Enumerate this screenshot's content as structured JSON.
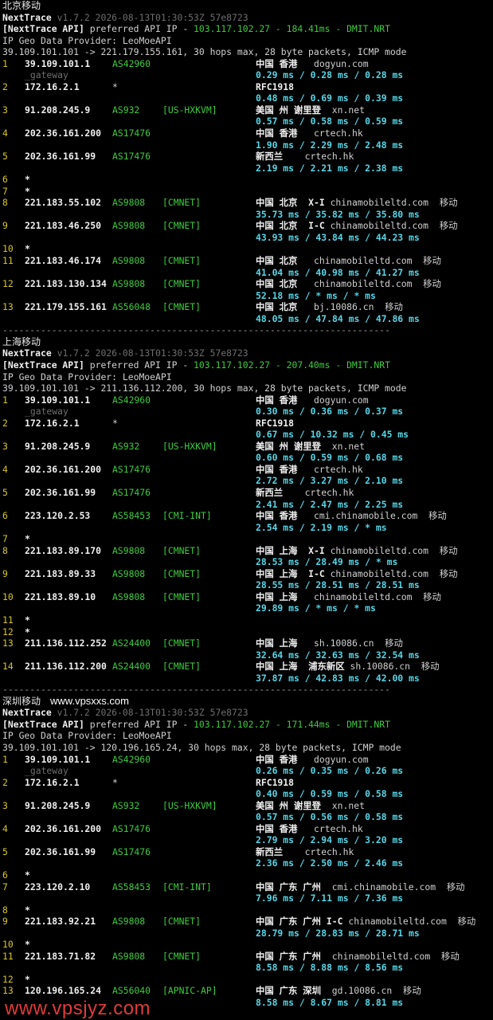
{
  "sections": [
    {
      "title": "北京移动",
      "site": "",
      "version_name": "NextTrace",
      "version_info": "v1.7.2 2026-08-13T01:30:53Z 57e8723",
      "api_prefix": "[NextTrace API]",
      "api_text": " preferred API IP - ",
      "api_ip": "103.117.102.27",
      "api_sep1": " - ",
      "api_ms": "184.41ms",
      "api_sep2": " - ",
      "api_node": "DMIT.NRT",
      "geo_provider": "IP Geo Data Provider: LeoMoeAPI",
      "trace_line": "39.109.101.101 -> 221.179.155.161, 30 hops max, 28 byte packets, ICMP mode",
      "hops": [
        {
          "n": "1",
          "ip": "39.109.101.1",
          "asn": "AS42960",
          "tag": "",
          "geo": "中国 香港",
          "host": "   dogyun.com",
          "isp": "",
          "rtt": "0.29 ms / 0.28 ms / 0.28 ms",
          "sub": "_gateway"
        },
        {
          "n": "2",
          "ip": "172.16.2.1",
          "asn": "*",
          "tag": "",
          "geo": "RFC1918",
          "host": "",
          "isp": "",
          "rtt": "0.48 ms / 0.69 ms / 0.39 ms",
          "sub": ""
        },
        {
          "n": "3",
          "ip": "91.208.245.9",
          "asn": "AS932",
          "tag": "[US-HXKVM]",
          "geo": "美国 州 谢里登",
          "host": "  xn.net",
          "isp": "",
          "rtt": "0.57 ms / 0.58 ms / 0.59 ms",
          "sub": ""
        },
        {
          "n": "4",
          "ip": "202.36.161.200",
          "asn": "AS17476",
          "tag": "",
          "geo": "中国 香港",
          "host": "   crtech.hk",
          "isp": "",
          "rtt": "1.90 ms / 2.29 ms / 2.48 ms",
          "sub": ""
        },
        {
          "n": "5",
          "ip": "202.36.161.99",
          "asn": "AS17476",
          "tag": "",
          "geo": "新西兰",
          "host": "    crtech.hk",
          "isp": "",
          "rtt": "2.19 ms / 2.21 ms / 2.38 ms",
          "sub": ""
        },
        {
          "n": "6",
          "ip": "*",
          "asn": "",
          "tag": "",
          "geo": "",
          "host": "",
          "isp": "",
          "rtt": "",
          "sub": ""
        },
        {
          "n": "7",
          "ip": "*",
          "asn": "",
          "tag": "",
          "geo": "",
          "host": "",
          "isp": "",
          "rtt": "",
          "sub": ""
        },
        {
          "n": "8",
          "ip": "221.183.55.102",
          "asn": "AS9808",
          "tag": "[CMNET]",
          "geo": "中国 北京  X-I",
          "host": " chinamobileltd.com",
          "isp": "  移动",
          "rtt": "35.73 ms / 35.82 ms / 35.80 ms",
          "sub": ""
        },
        {
          "n": "9",
          "ip": "221.183.46.250",
          "asn": "AS9808",
          "tag": "[CMNET]",
          "geo": "中国 北京  I-C",
          "host": " chinamobileltd.com",
          "isp": "  移动",
          "rtt": "43.93 ms / 43.84 ms / 44.23 ms",
          "sub": ""
        },
        {
          "n": "10",
          "ip": "*",
          "asn": "",
          "tag": "",
          "geo": "",
          "host": "",
          "isp": "",
          "rtt": "",
          "sub": ""
        },
        {
          "n": "11",
          "ip": "221.183.46.174",
          "asn": "AS9808",
          "tag": "[CMNET]",
          "geo": "中国 北京",
          "host": "   chinamobileltd.com",
          "isp": "  移动",
          "rtt": "41.04 ms / 40.98 ms / 41.27 ms",
          "sub": ""
        },
        {
          "n": "12",
          "ip": "221.183.130.134",
          "asn": "AS9808",
          "tag": "[CMNET]",
          "geo": "中国 北京",
          "host": "   chinamobileltd.com",
          "isp": "  移动",
          "rtt": "52.18 ms / * ms / * ms",
          "sub": ""
        },
        {
          "n": "13",
          "ip": "221.179.155.161",
          "asn": "AS56048",
          "tag": "[CMNET]",
          "geo": "中国 北京",
          "host": "   bj.10086.cn",
          "isp": "  移动",
          "rtt": "48.05 ms / 47.84 ms / 47.86 ms",
          "sub": ""
        }
      ]
    },
    {
      "title": "上海移动",
      "site": "",
      "version_name": "NextTrace",
      "version_info": "v1.7.2 2026-08-13T01:30:53Z 57e8723",
      "api_prefix": "[NextTrace API]",
      "api_text": " preferred API IP - ",
      "api_ip": "103.117.102.27",
      "api_sep1": " - ",
      "api_ms": "207.40ms",
      "api_sep2": " - ",
      "api_node": "DMIT.NRT",
      "geo_provider": "IP Geo Data Provider: LeoMoeAPI",
      "trace_line": "39.109.101.101 -> 211.136.112.200, 30 hops max, 28 byte packets, ICMP mode",
      "hops": [
        {
          "n": "1",
          "ip": "39.109.101.1",
          "asn": "AS42960",
          "tag": "",
          "geo": "中国 香港",
          "host": "   dogyun.com",
          "isp": "",
          "rtt": "0.30 ms / 0.36 ms / 0.37 ms",
          "sub": "_gateway"
        },
        {
          "n": "2",
          "ip": "172.16.2.1",
          "asn": "*",
          "tag": "",
          "geo": "RFC1918",
          "host": "",
          "isp": "",
          "rtt": "0.67 ms / 10.32 ms / 0.45 ms",
          "sub": ""
        },
        {
          "n": "3",
          "ip": "91.208.245.9",
          "asn": "AS932",
          "tag": "[US-HXKVM]",
          "geo": "美国 州 谢里登",
          "host": "  xn.net",
          "isp": "",
          "rtt": "0.60 ms / 0.59 ms / 0.68 ms",
          "sub": ""
        },
        {
          "n": "4",
          "ip": "202.36.161.200",
          "asn": "AS17476",
          "tag": "",
          "geo": "中国 香港",
          "host": "   crtech.hk",
          "isp": "",
          "rtt": "2.72 ms / 3.27 ms / 2.10 ms",
          "sub": ""
        },
        {
          "n": "5",
          "ip": "202.36.161.99",
          "asn": "AS17476",
          "tag": "",
          "geo": "新西兰",
          "host": "    crtech.hk",
          "isp": "",
          "rtt": "2.41 ms / 2.47 ms / 2.25 ms",
          "sub": ""
        },
        {
          "n": "6",
          "ip": "223.120.2.53",
          "asn": "AS58453",
          "tag": "[CMI-INT]",
          "geo": "中国 香港",
          "host": "   cmi.chinamobile.com",
          "isp": "  移动",
          "rtt": "2.54 ms / 2.19 ms / * ms",
          "sub": ""
        },
        {
          "n": "7",
          "ip": "*",
          "asn": "",
          "tag": "",
          "geo": "",
          "host": "",
          "isp": "",
          "rtt": "",
          "sub": ""
        },
        {
          "n": "8",
          "ip": "221.183.89.170",
          "asn": "AS9808",
          "tag": "[CMNET]",
          "geo": "中国 上海  X-I",
          "host": " chinamobileltd.com",
          "isp": "  移动",
          "rtt": "28.53 ms / 28.49 ms / * ms",
          "sub": ""
        },
        {
          "n": "9",
          "ip": "221.183.89.33",
          "asn": "AS9808",
          "tag": "[CMNET]",
          "geo": "中国 上海  I-C",
          "host": " chinamobileltd.com",
          "isp": "  移动",
          "rtt": "28.55 ms / 28.51 ms / 28.51 ms",
          "sub": ""
        },
        {
          "n": "10",
          "ip": "221.183.89.10",
          "asn": "AS9808",
          "tag": "[CMNET]",
          "geo": "中国 上海",
          "host": "   chinamobileltd.com",
          "isp": "  移动",
          "rtt": "29.89 ms / * ms / * ms",
          "sub": ""
        },
        {
          "n": "11",
          "ip": "*",
          "asn": "",
          "tag": "",
          "geo": "",
          "host": "",
          "isp": "",
          "rtt": "",
          "sub": ""
        },
        {
          "n": "12",
          "ip": "*",
          "asn": "",
          "tag": "",
          "geo": "",
          "host": "",
          "isp": "",
          "rtt": "",
          "sub": ""
        },
        {
          "n": "13",
          "ip": "211.136.112.252",
          "asn": "AS24400",
          "tag": "[CMNET]",
          "geo": "中国 上海",
          "host": "   sh.10086.cn",
          "isp": "  移动",
          "rtt": "32.64 ms / 32.63 ms / 32.54 ms",
          "sub": ""
        },
        {
          "n": "14",
          "ip": "211.136.112.200",
          "asn": "AS24400",
          "tag": "[CMNET]",
          "geo": "中国 上海  浦东新区",
          "host": " sh.10086.cn",
          "isp": "  移动",
          "rtt": "37.87 ms / 42.83 ms / 42.00 ms",
          "sub": ""
        }
      ]
    },
    {
      "title": "深圳移动",
      "site": "www.vpsxxs.com",
      "version_name": "NextTrace",
      "version_info": "v1.7.2 2026-08-13T01:30:53Z 57e8723",
      "api_prefix": "[NextTrace API]",
      "api_text": " preferred API IP - ",
      "api_ip": "103.117.102.27",
      "api_sep1": " - ",
      "api_ms": "171.44ms",
      "api_sep2": " - ",
      "api_node": "DMIT.NRT",
      "geo_provider": "IP Geo Data Provider: LeoMoeAPI",
      "trace_line": "39.109.101.101 -> 120.196.165.24, 30 hops max, 28 byte packets, ICMP mode",
      "hops": [
        {
          "n": "1",
          "ip": "39.109.101.1",
          "asn": "AS42960",
          "tag": "",
          "geo": "中国 香港",
          "host": "   dogyun.com",
          "isp": "",
          "rtt": "0.26 ms / 0.35 ms / 0.26 ms",
          "sub": "_gateway"
        },
        {
          "n": "2",
          "ip": "172.16.2.1",
          "asn": "*",
          "tag": "",
          "geo": "RFC1918",
          "host": "",
          "isp": "",
          "rtt": "0.40 ms / 0.59 ms / 0.58 ms",
          "sub": ""
        },
        {
          "n": "3",
          "ip": "91.208.245.9",
          "asn": "AS932",
          "tag": "[US-HXKVM]",
          "geo": "美国 州 谢里登",
          "host": "  xn.net",
          "isp": "",
          "rtt": "0.57 ms / 0.56 ms / 0.58 ms",
          "sub": ""
        },
        {
          "n": "4",
          "ip": "202.36.161.200",
          "asn": "AS17476",
          "tag": "",
          "geo": "中国 香港",
          "host": "   crtech.hk",
          "isp": "",
          "rtt": "2.79 ms / 2.94 ms / 3.20 ms",
          "sub": ""
        },
        {
          "n": "5",
          "ip": "202.36.161.99",
          "asn": "AS17476",
          "tag": "",
          "geo": "新西兰",
          "host": "    crtech.hk",
          "isp": "",
          "rtt": "2.36 ms / 2.50 ms / 2.46 ms",
          "sub": ""
        },
        {
          "n": "6",
          "ip": "*",
          "asn": "",
          "tag": "",
          "geo": "",
          "host": "",
          "isp": "",
          "rtt": "",
          "sub": ""
        },
        {
          "n": "7",
          "ip": "223.120.2.10",
          "asn": "AS58453",
          "tag": "[CMI-INT]",
          "geo": "中国 广东 广州",
          "host": "  cmi.chinamobile.com",
          "isp": "  移动",
          "rtt": "7.96 ms / 7.11 ms / 7.36 ms",
          "sub": ""
        },
        {
          "n": "8",
          "ip": "*",
          "asn": "",
          "tag": "",
          "geo": "",
          "host": "",
          "isp": "",
          "rtt": "",
          "sub": ""
        },
        {
          "n": "9",
          "ip": "221.183.92.21",
          "asn": "AS9808",
          "tag": "[CMNET]",
          "geo": "中国 广东 广州 I-C",
          "host": " chinamobileltd.com",
          "isp": "  移动",
          "rtt": "28.79 ms / 28.83 ms / 28.71 ms",
          "sub": ""
        },
        {
          "n": "10",
          "ip": "*",
          "asn": "",
          "tag": "",
          "geo": "",
          "host": "",
          "isp": "",
          "rtt": "",
          "sub": ""
        },
        {
          "n": "11",
          "ip": "221.183.71.82",
          "asn": "AS9808",
          "tag": "[CMNET]",
          "geo": "中国 广东 广州",
          "host": "  chinamobileltd.com",
          "isp": "  移动",
          "rtt": "8.58 ms / 8.88 ms / 8.56 ms",
          "sub": ""
        },
        {
          "n": "12",
          "ip": "*",
          "asn": "",
          "tag": "",
          "geo": "",
          "host": "",
          "isp": "",
          "rtt": "",
          "sub": ""
        },
        {
          "n": "13",
          "ip": "120.196.165.24",
          "asn": "AS56040",
          "tag": "[APNIC-AP]",
          "geo": "中国 广东 深圳",
          "host": "  gd.10086.cn",
          "isp": "  移动",
          "rtt": "8.58 ms / 8.67 ms / 8.81 ms",
          "sub": ""
        }
      ]
    }
  ],
  "separator": "-----------------------------------------------------------------------",
  "watermark": "www.vpsjyz.com",
  "colors": {
    "background": "#000000",
    "hop_number": "#d8c626",
    "asn": "#3ecb3e",
    "rtt": "#56d6e6",
    "api_ip": "#3ecb3e",
    "watermark": "#e23a3a"
  }
}
